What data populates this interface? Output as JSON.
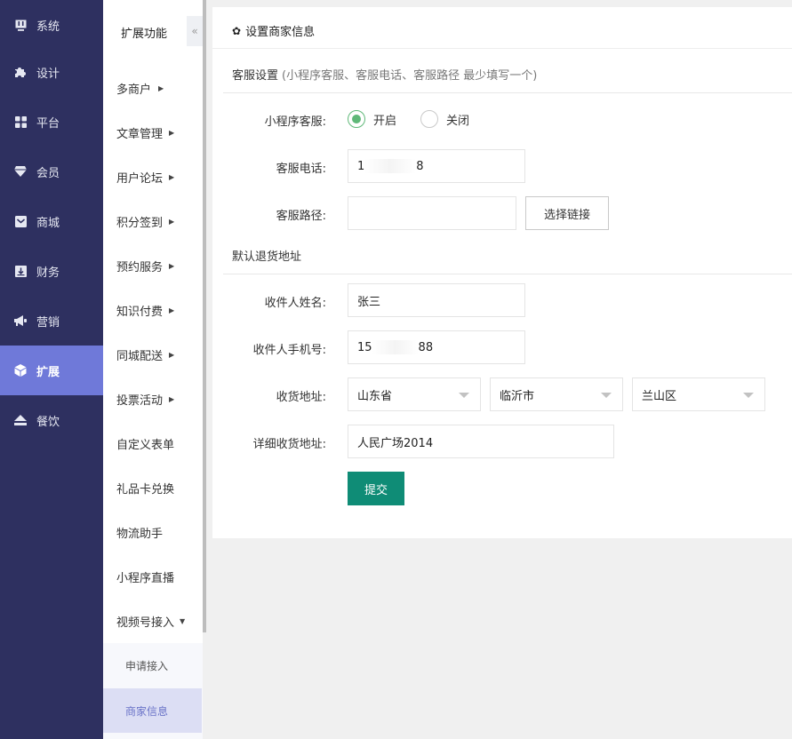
{
  "nav": {
    "items": [
      {
        "label": "系统",
        "icon": "monitor-icon"
      },
      {
        "label": "设计",
        "icon": "puzzle-icon"
      },
      {
        "label": "平台",
        "icon": "grid-icon"
      },
      {
        "label": "会员",
        "icon": "diamond-icon"
      },
      {
        "label": "商城",
        "icon": "mail-icon"
      },
      {
        "label": "财务",
        "icon": "download-box-icon"
      },
      {
        "label": "营销",
        "icon": "megaphone-icon"
      },
      {
        "label": "扩展",
        "icon": "cube-icon"
      },
      {
        "label": "餐饮",
        "icon": "eject-icon"
      }
    ],
    "active_index": 7,
    "bg_color": "#2e3060",
    "active_color": "#6f79d9"
  },
  "submenu": {
    "title": "扩展功能",
    "collapse_glyph": "«",
    "items": [
      {
        "label": "多商户",
        "has_arrow": true
      },
      {
        "label": "文章管理",
        "has_arrow": true
      },
      {
        "label": "用户论坛",
        "has_arrow": true
      },
      {
        "label": "积分签到",
        "has_arrow": true
      },
      {
        "label": "预约服务",
        "has_arrow": true
      },
      {
        "label": "知识付费",
        "has_arrow": true
      },
      {
        "label": "同城配送",
        "has_arrow": true
      },
      {
        "label": "投票活动",
        "has_arrow": true
      },
      {
        "label": "自定义表单",
        "has_arrow": false
      },
      {
        "label": "礼品卡兑换",
        "has_arrow": false
      },
      {
        "label": "物流助手",
        "has_arrow": false
      },
      {
        "label": "小程序直播",
        "has_arrow": false
      },
      {
        "label": "视频号接入",
        "has_arrow": true,
        "expanded": true
      }
    ],
    "children": [
      {
        "label": "申请接入"
      },
      {
        "label": "商家信息",
        "selected": true
      }
    ]
  },
  "panel": {
    "title": "设置商家信息",
    "service_section": {
      "title": "客服设置",
      "hint": "(小程序客服、客服电话、客服路径 最少填写一个)"
    },
    "miniapp_service": {
      "label": "小程序客服:",
      "options": [
        "开启",
        "关闭"
      ],
      "selected": "开启"
    },
    "service_phone": {
      "label": "客服电话:",
      "value_start": "1",
      "value_end": "8"
    },
    "service_path": {
      "label": "客服路径:",
      "value": "",
      "button": "选择链接"
    },
    "return_section": {
      "title": "默认退货地址"
    },
    "receiver_name": {
      "label": "收件人姓名:",
      "value": "张三"
    },
    "receiver_phone": {
      "label": "收件人手机号:",
      "value_start": "15",
      "value_end": "88"
    },
    "address": {
      "label": "收货地址:",
      "province": "山东省",
      "city": "临沂市",
      "district": "兰山区"
    },
    "detail_address": {
      "label": "详细收货地址:",
      "value": "人民广场2014"
    },
    "submit_label": "提交",
    "accent_color": "#0f8c76",
    "radio_color": "#5fb878"
  }
}
